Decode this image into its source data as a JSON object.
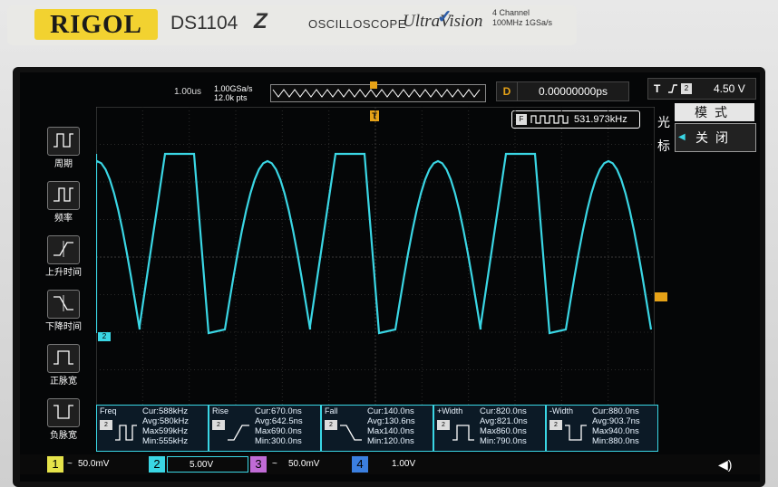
{
  "device": {
    "brand": "RIGOL",
    "model": "DS1104",
    "model_suffix": "Z",
    "type_label": "OSCILLOSCOPE",
    "product_line": "UltraVision",
    "spec_line1": "4 Channel",
    "spec_line2": "100MHz 1GSa/s"
  },
  "topbar": {
    "timebase": "1.00us",
    "sample_rate": "1.00GSa/s",
    "points": "12.0k pts",
    "delay_label": "D",
    "delay_value": "0.00000000ps",
    "trigger_label": "T",
    "trigger_edge": "rising-edge",
    "trigger_source_icon": "ch2-icon",
    "trigger_level": "4.50 V"
  },
  "frequency_counter": {
    "icon": "counter-icon",
    "value": "531.973kHz"
  },
  "right_menu": {
    "side_label_top": "光",
    "side_label_bottom": "标",
    "mode_label": "模式",
    "off_label": "关闭"
  },
  "left_menu": [
    {
      "icon": "period-icon",
      "label": "周期"
    },
    {
      "icon": "frequency-icon",
      "label": "频率"
    },
    {
      "icon": "rise-time-icon",
      "label": "上升时间"
    },
    {
      "icon": "fall-time-icon",
      "label": "下降时间"
    },
    {
      "icon": "positive-width-icon",
      "label": "正脉宽"
    },
    {
      "icon": "negative-width-icon",
      "label": "负脉宽"
    }
  ],
  "measurements": [
    {
      "name": "Freq",
      "cur": "Cur:588kHz",
      "avg": "Avg:580kHz",
      "max": "Max599kHz",
      "min": "Min:555kHz"
    },
    {
      "name": "Rise",
      "cur": "Cur:670.0ns",
      "avg": "Avg:642.5ns",
      "max": "Max690.0ns",
      "min": "Min:300.0ns"
    },
    {
      "name": "Fall",
      "cur": "Cur:140.0ns",
      "avg": "Avg:130.6ns",
      "max": "Max140.0ns",
      "min": "Min:120.0ns"
    },
    {
      "name": "+Width",
      "cur": "Cur:820.0ns",
      "avg": "Avg:821.0ns",
      "max": "Max860.0ns",
      "min": "Min:790.0ns"
    },
    {
      "name": "-Width",
      "cur": "Cur:880.0ns",
      "avg": "Avg:903.7ns",
      "max": "Max940.0ns",
      "min": "Min:880.0ns"
    }
  ],
  "channels": [
    {
      "num": "1",
      "coupling": "~",
      "scale": "50.0mV",
      "color": "#e6e34a",
      "active": false
    },
    {
      "num": "2",
      "coupling": "",
      "scale": "5.00V",
      "color": "#3ad6e4",
      "active": true
    },
    {
      "num": "3",
      "coupling": "~",
      "scale": "50.0mV",
      "color": "#c06bd6",
      "active": false
    },
    {
      "num": "4",
      "coupling": "",
      "scale": "1.00V",
      "color": "#3b7fe0",
      "active": false
    }
  ],
  "trace_color": "#3ad6e4",
  "accent_color": "#e6a217"
}
